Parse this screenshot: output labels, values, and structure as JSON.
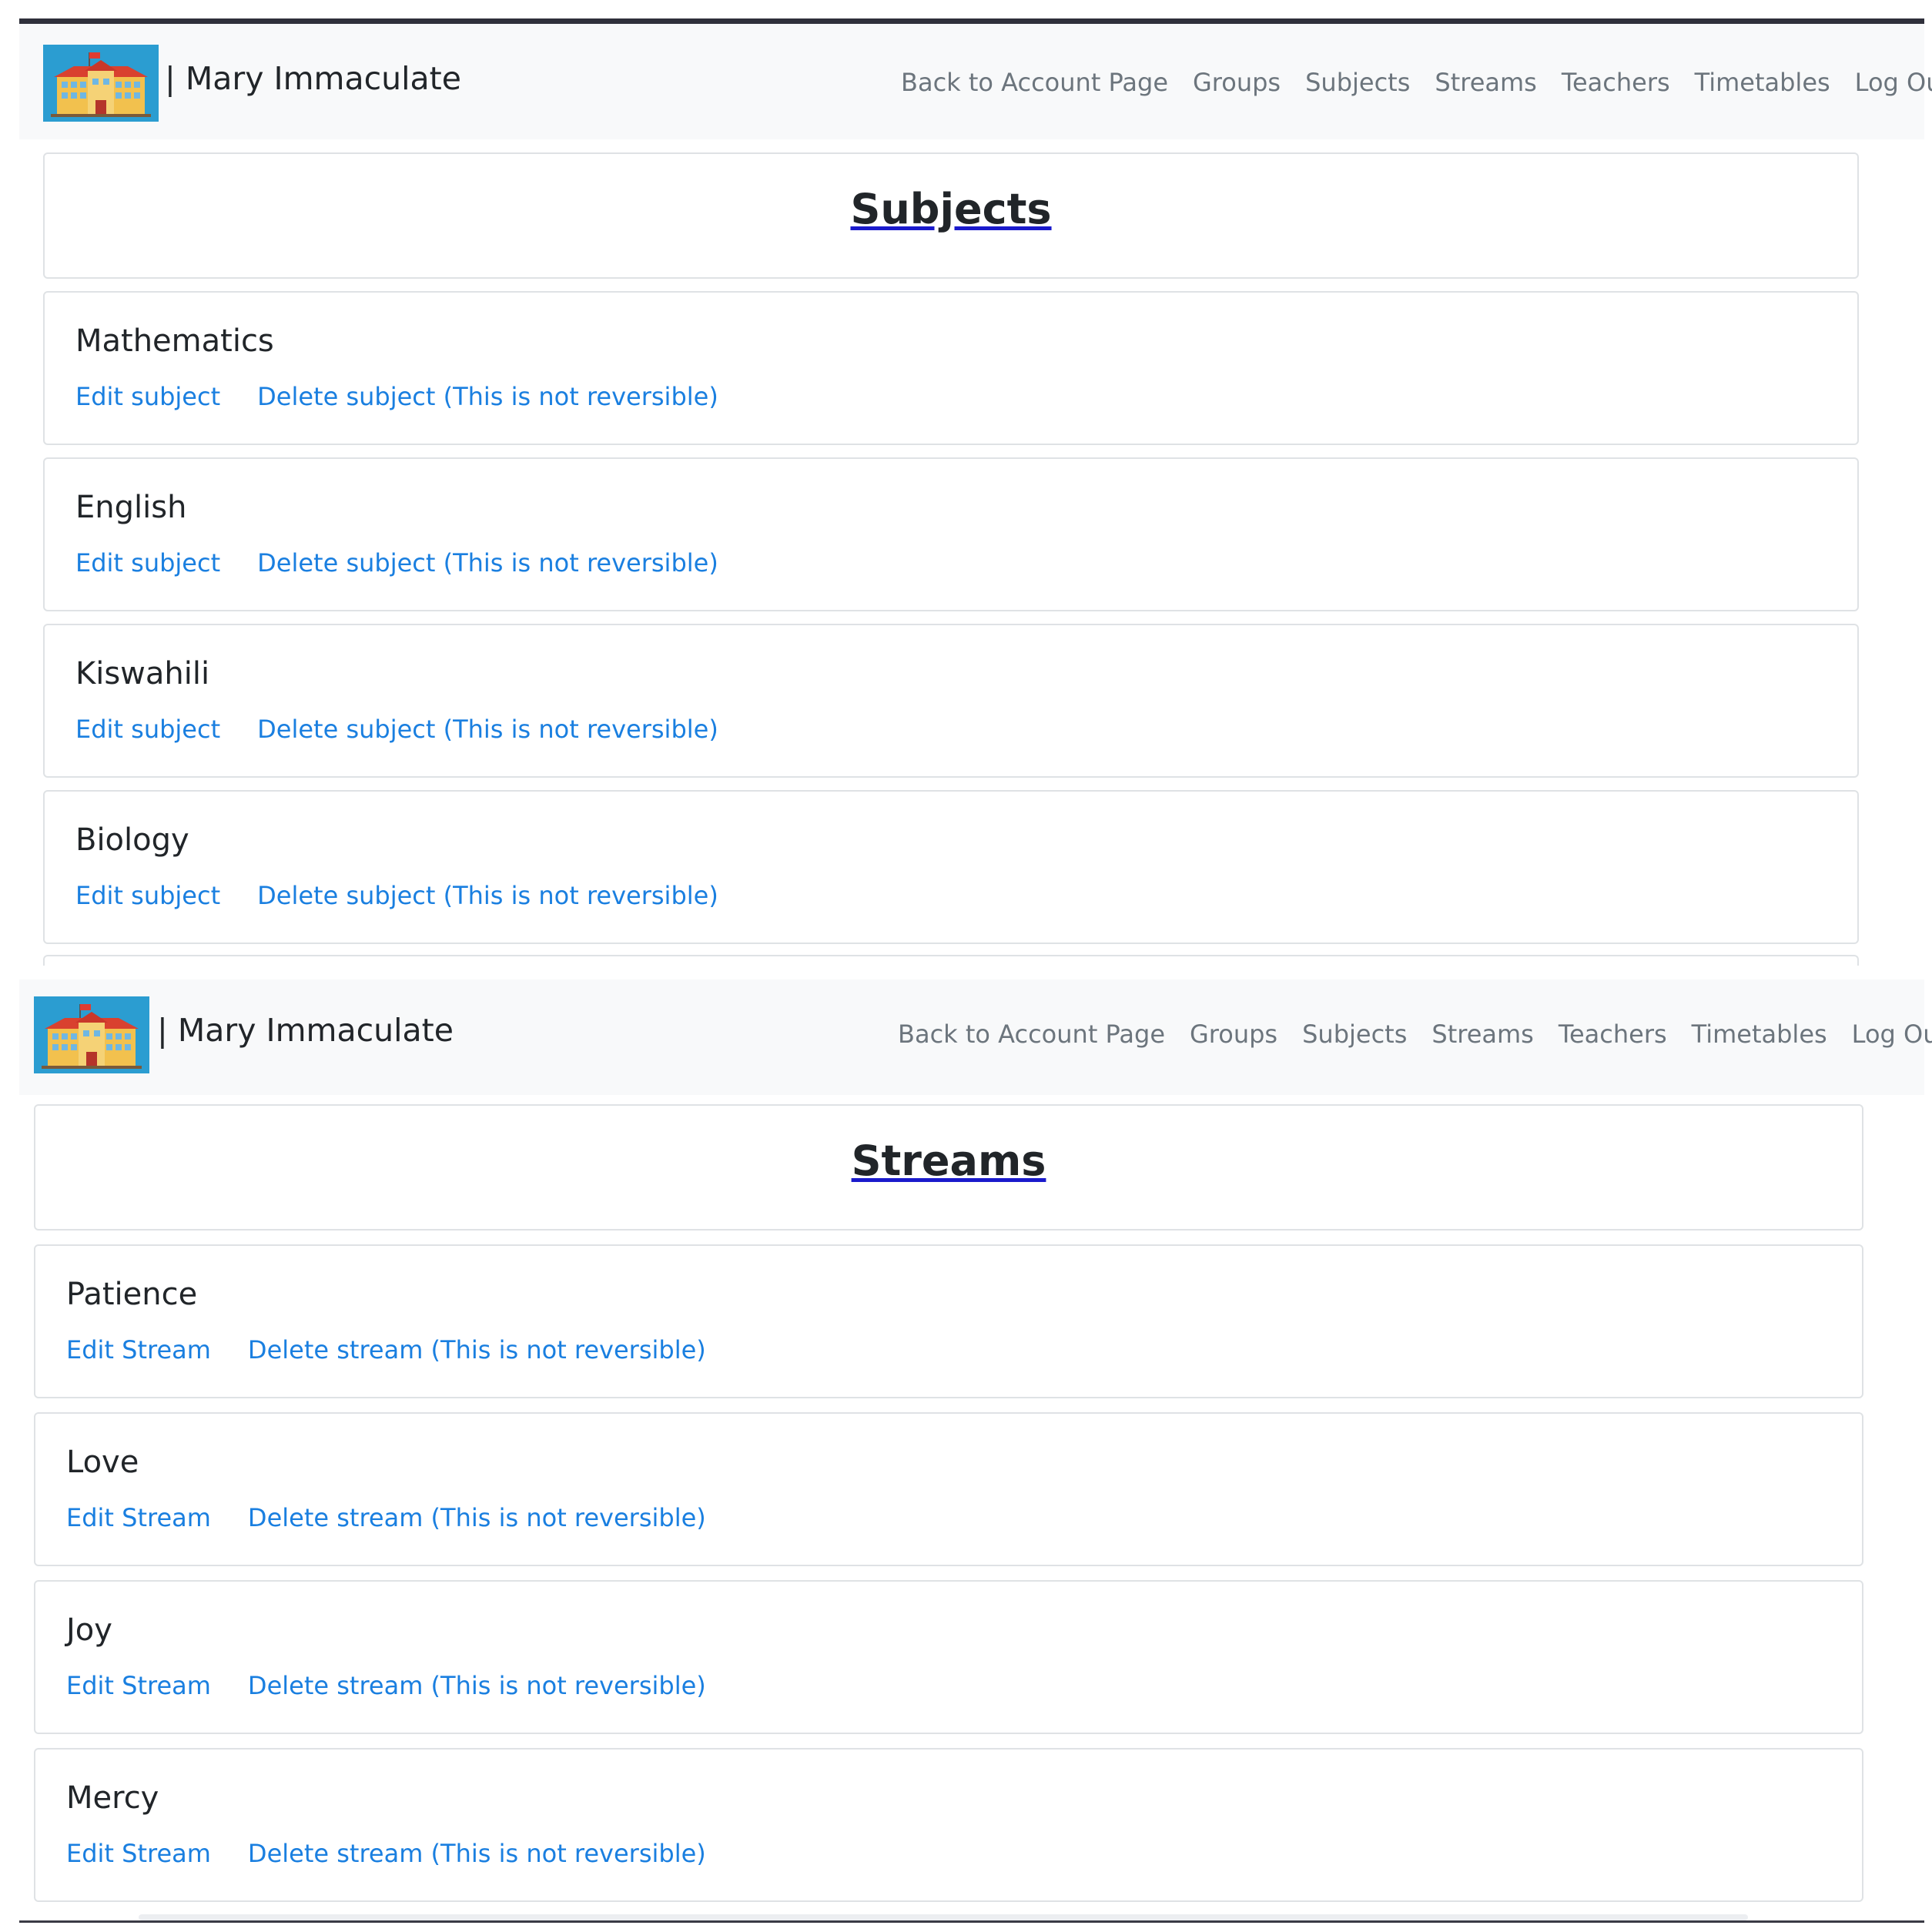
{
  "screens": [
    {
      "brand": "| Mary Immaculate",
      "nav": [
        "Back to Account Page",
        "Groups",
        "Subjects",
        "Streams",
        "Teachers",
        "Timetables",
        "Log Out"
      ],
      "heading": "Subjects",
      "items": [
        {
          "name": "Mathematics",
          "edit": "Edit subject",
          "delete": "Delete subject (This is not reversible)"
        },
        {
          "name": "English",
          "edit": "Edit subject",
          "delete": "Delete subject (This is not reversible)"
        },
        {
          "name": "Kiswahili",
          "edit": "Edit subject",
          "delete": "Delete subject (This is not reversible)"
        },
        {
          "name": "Biology",
          "edit": "Edit subject",
          "delete": "Delete subject (This is not reversible)"
        }
      ]
    },
    {
      "brand": "| Mary Immaculate",
      "nav": [
        "Back to Account Page",
        "Groups",
        "Subjects",
        "Streams",
        "Teachers",
        "Timetables",
        "Log Out"
      ],
      "heading": "Streams",
      "items": [
        {
          "name": "Patience",
          "edit": "Edit Stream",
          "delete": "Delete stream (This is not reversible)"
        },
        {
          "name": "Love",
          "edit": "Edit Stream",
          "delete": "Delete stream (This is not reversible)"
        },
        {
          "name": "Joy",
          "edit": "Edit Stream",
          "delete": "Delete stream (This is not reversible)"
        },
        {
          "name": "Mercy",
          "edit": "Edit Stream",
          "delete": "Delete stream (This is not reversible)"
        }
      ]
    }
  ],
  "colors": {
    "link": "#1a7fe0",
    "nav_text": "#6c757d",
    "navbar_bg": "#f8f9fa",
    "logo_bg": "#2b9dd1"
  }
}
